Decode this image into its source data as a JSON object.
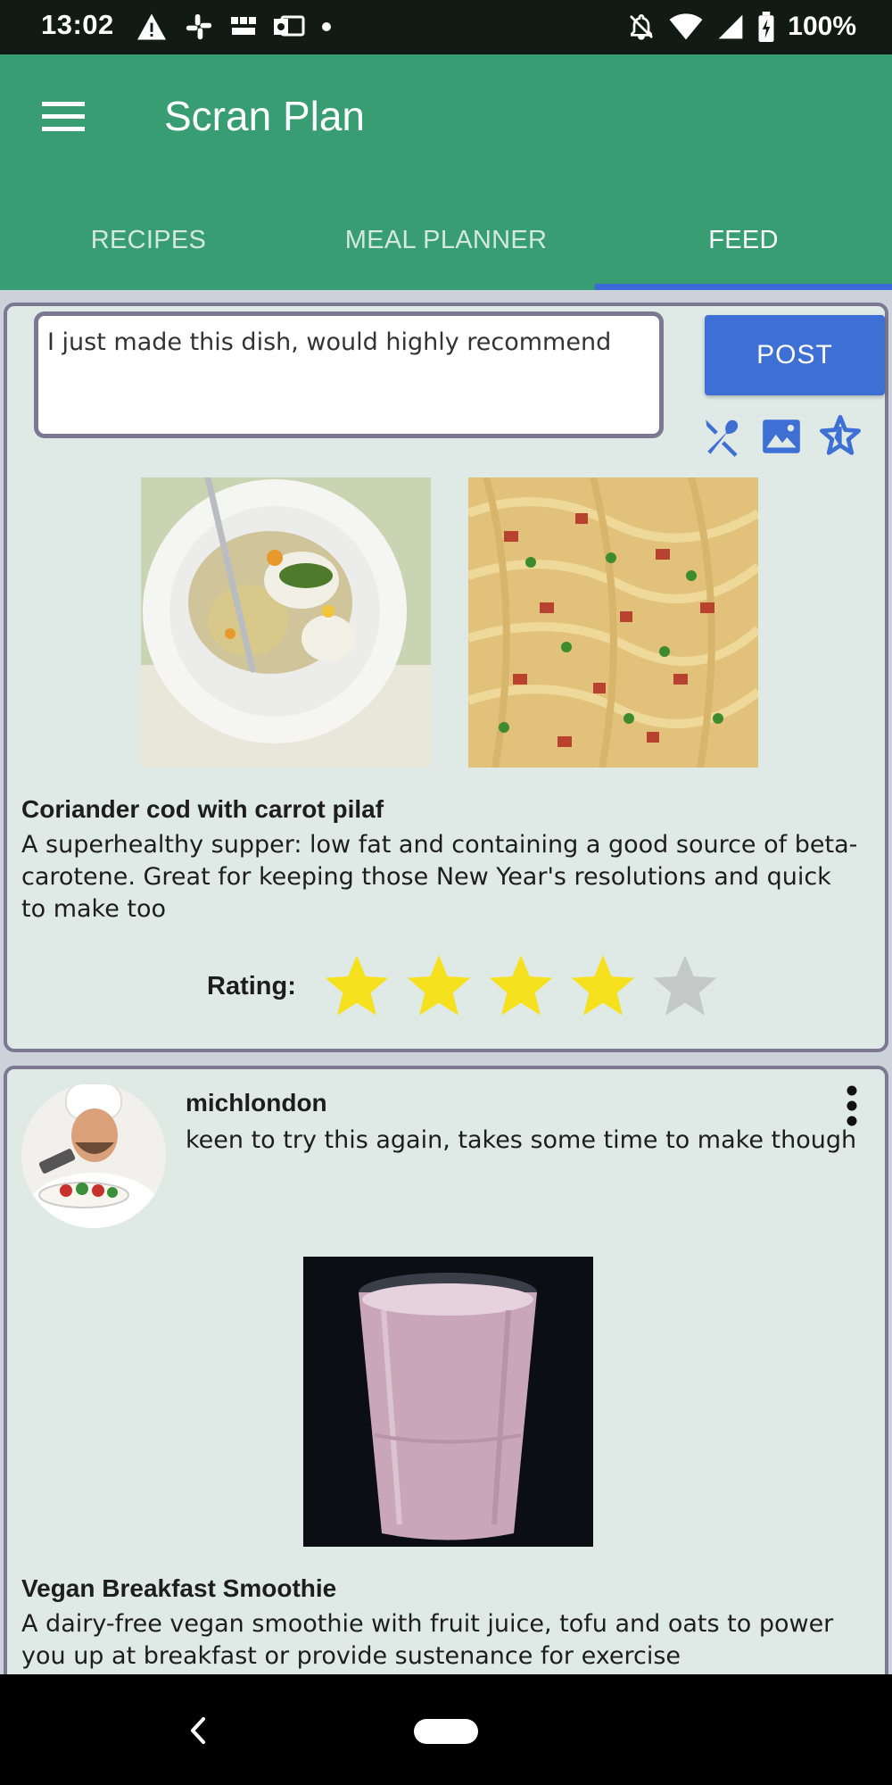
{
  "status_bar": {
    "time": "13:02",
    "battery": "100%",
    "icons_left": [
      "warning-icon",
      "slack-icon",
      "bbc-news-icon",
      "outlook-icon",
      "dot-icon"
    ],
    "icons_right": [
      "notifications-off-icon",
      "wifi-icon",
      "signal-icon",
      "battery-charging-icon"
    ]
  },
  "app_bar": {
    "title": "Scran Plan",
    "menu_icon": "hamburger-menu-icon",
    "background": "#389d72"
  },
  "tabs": [
    {
      "label": "RECIPES",
      "selected": false
    },
    {
      "label": "MEAL PLANNER",
      "selected": false
    },
    {
      "label": "FEED",
      "selected": true
    }
  ],
  "compose": {
    "input_value": "I just made this dish, would highly recommend",
    "post_label": "POST",
    "post_color": "#3e6fd4",
    "tools": [
      "restaurant-icon",
      "image-icon",
      "star-add-icon"
    ],
    "recipe": {
      "title": "Coriander cod with carrot pilaf",
      "description": "A superhealthy supper: low fat and containing a good source of beta-carotene. Great for keeping those New Year's resolutions and quick to make too"
    },
    "rating": {
      "label": "Rating:",
      "value": 4,
      "max": 5,
      "filled_color": "#f6e11e",
      "empty_color": "#c4c8c7"
    }
  },
  "feed": [
    {
      "username": "michlondon",
      "comment": "keen to try this again, takes some time to make though",
      "recipe_title": "Vegan Breakfast Smoothie",
      "recipe_description": "A dairy-free vegan smoothie with fruit juice, tofu and oats to power you up at breakfast or provide sustenance for exercise"
    }
  ]
}
